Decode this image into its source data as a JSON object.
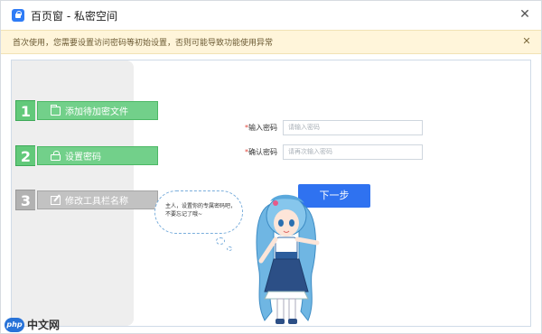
{
  "window": {
    "title": "百页窗 - 私密空间"
  },
  "notice": {
    "text": "首次使用，您需要设置访问密码等初始设置，否则可能导致功能使用异常"
  },
  "steps": [
    {
      "number": "1",
      "label": "添加待加密文件",
      "icon": "folder-icon",
      "state": "done"
    },
    {
      "number": "2",
      "label": "设置密码",
      "icon": "lock-icon",
      "state": "active"
    },
    {
      "number": "3",
      "label": "修改工具栏名称",
      "icon": "edit-icon",
      "state": "pending"
    }
  ],
  "form": {
    "password": {
      "required_mark": "*",
      "label": "输入密码",
      "placeholder": "请输入密码"
    },
    "confirm": {
      "required_mark": "*",
      "label": "确认密码",
      "placeholder": "请再次输入密码"
    },
    "next_label": "下一步"
  },
  "bubble": {
    "text": "主人，设置你的专属密码吧，不要忘记了哦~"
  },
  "watermark": {
    "logo": "php",
    "text": "中文网"
  },
  "colors": {
    "accent": "#2f72f0",
    "step_done": "#72d08a",
    "step_pending": "#c2c2c2",
    "notice_bg": "#fff5da",
    "required": "#e0453a"
  }
}
